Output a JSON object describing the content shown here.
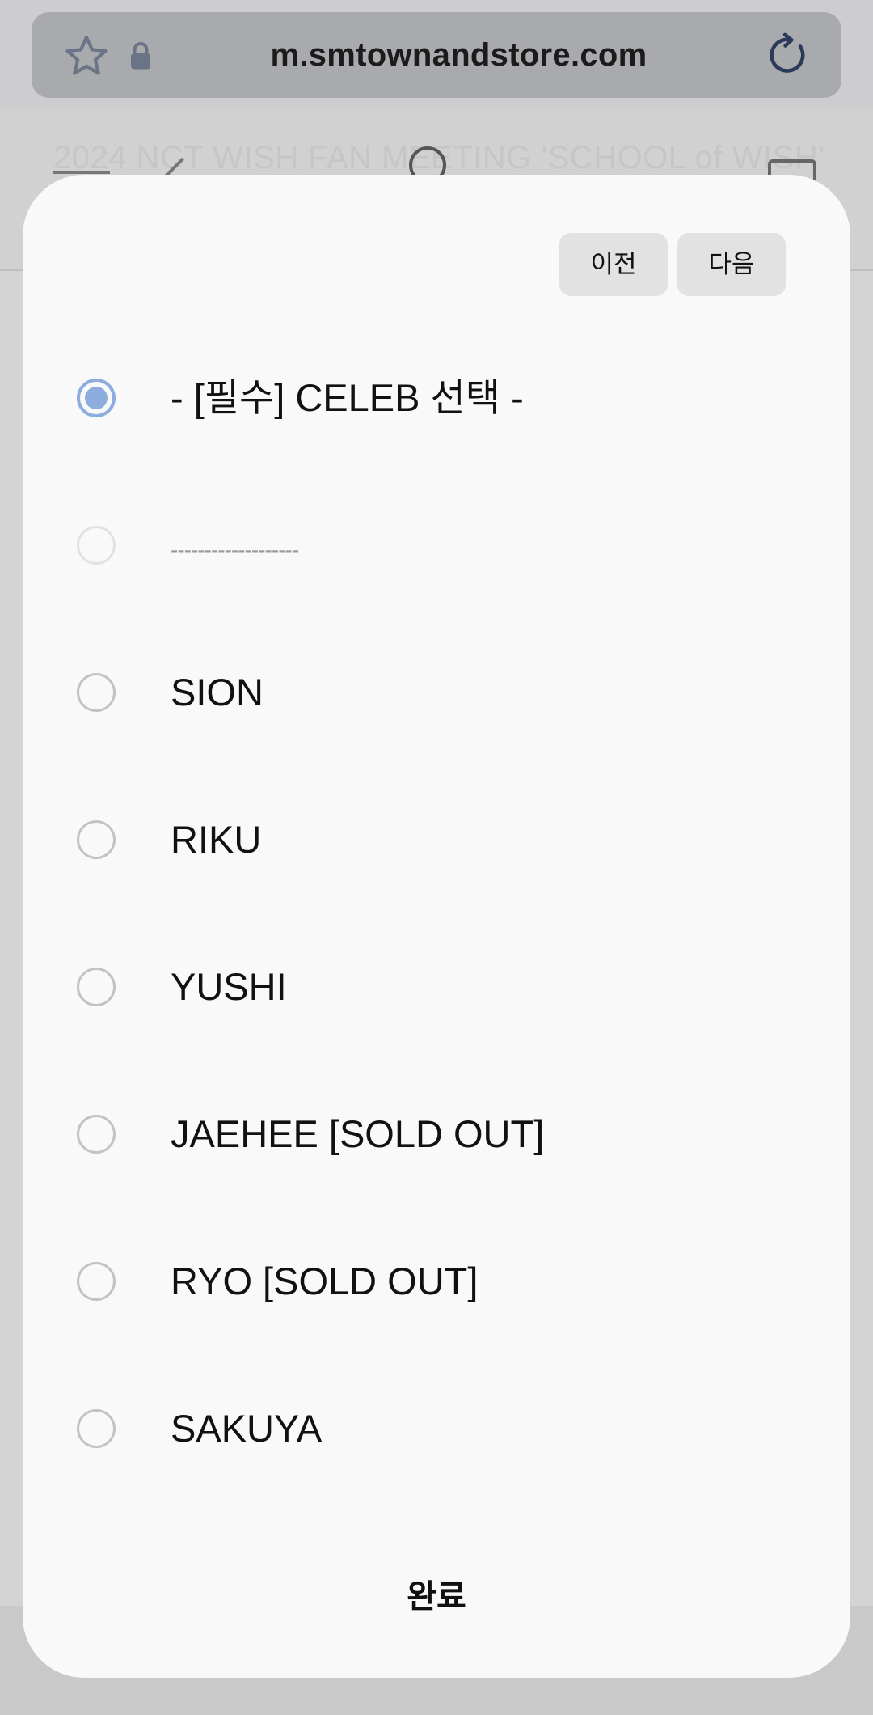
{
  "browser": {
    "url": "m.smtownandstore.com"
  },
  "page": {
    "title": "2024 NCT WISH FAN MEETING 'SCHOOL of WISH'"
  },
  "modal": {
    "prev_label": "이전",
    "next_label": "다음",
    "options": [
      {
        "label": "- [필수] CELEB 선택 -",
        "state": "selected"
      },
      {
        "label": "-------------------",
        "state": "disabled"
      },
      {
        "label": "SION",
        "state": "unselected"
      },
      {
        "label": "RIKU",
        "state": "unselected"
      },
      {
        "label": "YUSHI",
        "state": "unselected"
      },
      {
        "label": "JAEHEE [SOLD OUT]",
        "state": "unselected"
      },
      {
        "label": "RYO [SOLD OUT]",
        "state": "unselected"
      },
      {
        "label": "SAKUYA",
        "state": "unselected"
      }
    ],
    "done_label": "완료"
  },
  "colors": {
    "radio_selected": "#8cadde",
    "radio_unselected": "#c3c3c3",
    "sheet_background": "#f9f9f9",
    "url_bar": "#a9aaae"
  }
}
